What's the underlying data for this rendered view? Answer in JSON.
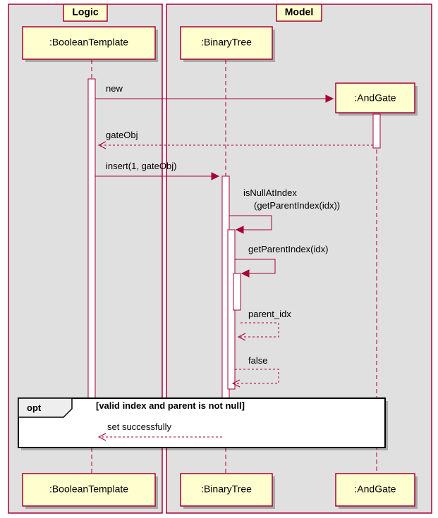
{
  "groups": {
    "logic": {
      "title": "Logic"
    },
    "model": {
      "title": "Model"
    }
  },
  "participants": {
    "boolTemplate": {
      "label": ":BooleanTemplate"
    },
    "binaryTree": {
      "label": ":BinaryTree"
    },
    "andGate": {
      "label": ":AndGate"
    }
  },
  "messages": {
    "new": "new",
    "gateObj": "gateObj",
    "insert": "insert(1, gateObj)",
    "isNull1": "isNullAtIndex",
    "isNull2": "(getParentIndex(idx))",
    "getParent": "getParentIndex(idx)",
    "parentIdx": "parent_idx",
    "falseRet": "false",
    "setOk": "set successfully"
  },
  "opt": {
    "label": "opt",
    "guard": "[valid index and parent is not null]"
  }
}
